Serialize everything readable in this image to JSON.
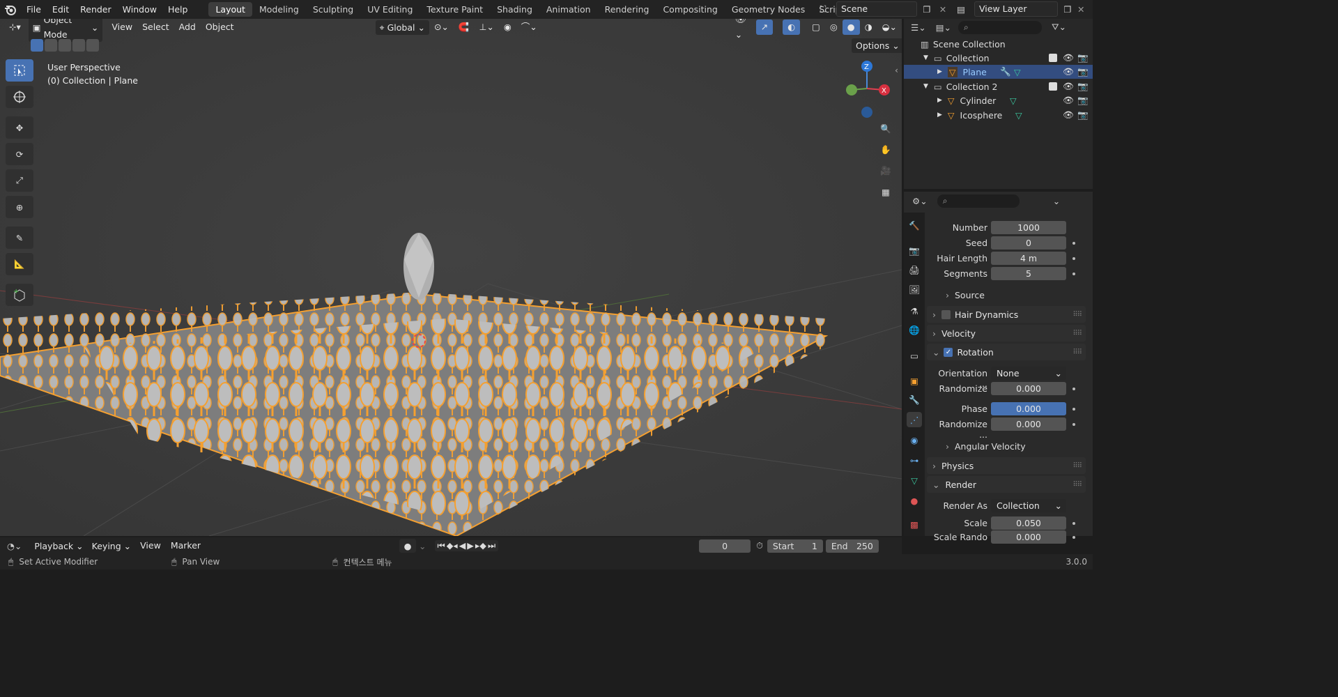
{
  "topbar": {
    "menus": [
      "File",
      "Edit",
      "Render",
      "Window",
      "Help"
    ],
    "workspace_tabs": [
      "Layout",
      "Modeling",
      "Sculpting",
      "UV Editing",
      "Texture Paint",
      "Shading",
      "Animation",
      "Rendering",
      "Compositing",
      "Geometry Nodes",
      "Scripting"
    ],
    "active_tab": "Layout",
    "scene_name": "Scene",
    "view_layer_name": "View Layer"
  },
  "viewport_header": {
    "mode": "Object Mode",
    "menus": [
      "View",
      "Select",
      "Add",
      "Object"
    ],
    "transform_orientation": "Global",
    "options_label": "Options"
  },
  "viewport": {
    "overlay_line1": "User Perspective",
    "overlay_line2": "(0) Collection | Plane",
    "gizmo_axes": {
      "z": "Z",
      "x": "X"
    }
  },
  "outliner": {
    "root": "Scene Collection",
    "items": [
      {
        "label": "Collection",
        "type": "collection",
        "indent": 1
      },
      {
        "label": "Plane",
        "type": "object",
        "indent": 2,
        "selected": true
      },
      {
        "label": "Collection 2",
        "type": "collection",
        "indent": 1
      },
      {
        "label": "Cylinder",
        "type": "object",
        "indent": 2
      },
      {
        "label": "Icosphere",
        "type": "object",
        "indent": 2
      }
    ]
  },
  "properties": {
    "emission": {
      "number_label": "Number",
      "number": "1000",
      "seed_label": "Seed",
      "seed": "0",
      "hair_length_label": "Hair Length",
      "hair_length": "4 m",
      "segments_label": "Segments",
      "segments": "5"
    },
    "panels": {
      "source": "Source",
      "hair_dynamics": "Hair Dynamics",
      "velocity": "Velocity",
      "rotation": "Rotation",
      "angular_velocity": "Angular Velocity",
      "physics": "Physics",
      "render": "Render"
    },
    "rotation": {
      "orientation_label": "Orientation ...",
      "orientation": "None",
      "randomize_label": "Randomize",
      "randomize": "0.000",
      "phase_label": "Phase",
      "phase": "0.000",
      "randomize2_label": "Randomize ...",
      "randomize2": "0.000"
    },
    "render": {
      "render_as_label": "Render As",
      "render_as": "Collection",
      "scale_label": "Scale",
      "scale": "0.050",
      "scale_rando_label": "Scale Rando",
      "scale_rando": "0.000"
    }
  },
  "timeline": {
    "menus": [
      "Playback",
      "Keying",
      "View",
      "Marker"
    ],
    "current_frame": "0",
    "start_label": "Start",
    "start": "1",
    "end_label": "End",
    "end": "250"
  },
  "statusbar": {
    "left": "Set Active Modifier",
    "middle": "Pan View",
    "right": "컨텍스트 메뉴",
    "version": "3.0.0"
  },
  "colors": {
    "accent": "#4772b3",
    "selection_orange": "#f5a030",
    "panel_bg": "#2a2a2a",
    "viewport_bg": "#3d3d3d"
  }
}
